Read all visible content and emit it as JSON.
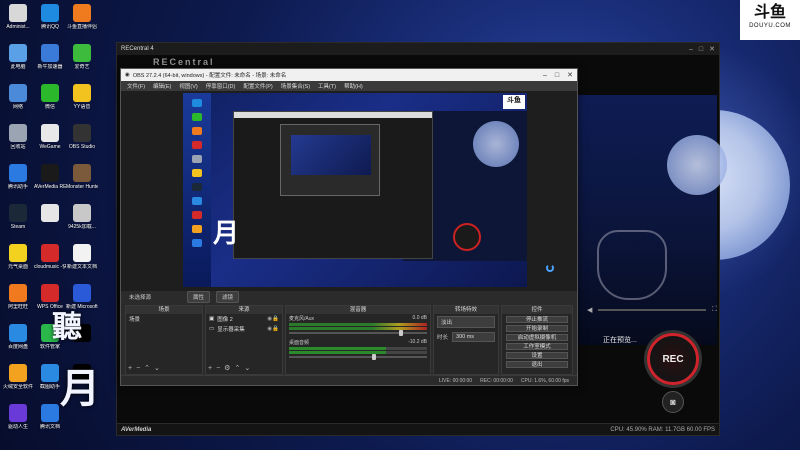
{
  "desktop": {
    "icons": [
      {
        "label": "Administ...",
        "color": "#d8d8d8"
      },
      {
        "label": "腾讯QQ",
        "color": "#1e8be0"
      },
      {
        "label": "斗鱼直播伴侣",
        "color": "#f07a1e"
      },
      {
        "label": "此电脑",
        "color": "#5aa0e6"
      },
      {
        "label": "新牛加速器",
        "color": "#3a7ad8"
      },
      {
        "label": "爱奇艺",
        "color": "#3dbb3d"
      },
      {
        "label": "网络",
        "color": "#4a8ad8"
      },
      {
        "label": "微信",
        "color": "#2bb82b"
      },
      {
        "label": "YY语音",
        "color": "#f2c21e"
      },
      {
        "label": "回收站",
        "color": "#9aa4b2"
      },
      {
        "label": "WeGame",
        "color": "#e8e8e8"
      },
      {
        "label": "OBS Studio",
        "color": "#333333"
      },
      {
        "label": "腾讯助手",
        "color": "#2a7ae2"
      },
      {
        "label": "AVerMedia RECentral 4",
        "color": "#1a1a1a"
      },
      {
        "label": "Monster Hunter...",
        "color": "#7a5a3a"
      },
      {
        "label": "Steam",
        "color": "#1b2838"
      },
      {
        "label": "",
        "color": "#e6e6e6"
      },
      {
        "label": "9425k加载...",
        "color": "#c8c8c8"
      },
      {
        "label": "元气桌面",
        "color": "#f2d21e"
      },
      {
        "label": "cloudmusic -快捷方式",
        "color": "#d42a2a"
      },
      {
        "label": "新建文本文档",
        "color": "#f2f2f2"
      },
      {
        "label": "阿里旺旺",
        "color": "#f27a1e"
      },
      {
        "label": "WPS Office",
        "color": "#d42a2a"
      },
      {
        "label": "新建 Microsoft Word 文档",
        "color": "#2a5ad8"
      },
      {
        "label": "百度网盘",
        "color": "#2a8ae2"
      },
      {
        "label": "软件管家",
        "color": "#2ab84a"
      },
      {
        "label": "",
        "color": "#000000"
      },
      {
        "label": "火绒安全软件",
        "color": "#f2a21e"
      },
      {
        "label": "截图助手",
        "color": "#2a8ae2"
      },
      {
        "label": "",
        "color": "#000000"
      },
      {
        "label": "驱动人生",
        "color": "#6a3ad8"
      },
      {
        "label": "腾讯文档",
        "color": "#2a7ae2"
      }
    ],
    "calligraphy": [
      "聽",
      "月",
      "月"
    ]
  },
  "douyu": {
    "mark": "斗鱼",
    "url": "DOUYU.COM"
  },
  "recentral": {
    "title": "RECentral 4",
    "logo": "RECentral",
    "preview_status": "正在预览...",
    "rec_label": "REC",
    "brand": "AVerMedia",
    "stats": "CPU: 45.90%  RAM: 11.7GB  60.00 FPS",
    "accent": "#d0242c"
  },
  "obs": {
    "title": "OBS 27.2.4 (64-bit, windows) - 配置文件: 未命名 - 场景: 未命名",
    "menu": [
      "文件(F)",
      "编辑(E)",
      "视图(V)",
      "停靠窗口(D)",
      "配置文件(P)",
      "场景集合(S)",
      "工具(T)",
      "帮助(H)"
    ],
    "status_label": "未选择源",
    "buttons": [
      "属性",
      "滤镜"
    ],
    "docks": {
      "scenes": {
        "header": "场景",
        "items": [
          "场景"
        ]
      },
      "sources": {
        "header": "来源",
        "items": [
          "图像 2",
          "显示器采集"
        ]
      },
      "mixer": {
        "header": "混音器",
        "channels": [
          {
            "name": "麦克风/Aux",
            "db": "0.0 dB"
          },
          {
            "name": "桌面音频",
            "db": "-10.2 dB"
          }
        ]
      },
      "transitions": {
        "header": "转场特效",
        "type": "淡出",
        "duration_label": "时长",
        "duration": "300 ms"
      },
      "controls": {
        "header": "控件",
        "buttons": [
          "停止推流",
          "开始录制",
          "启动虚拟摄像机",
          "工作室模式",
          "设置",
          "退出"
        ]
      }
    },
    "statusbar": [
      "LIVE: 00:00:00",
      "REC: 00:00:00",
      "CPU: 1.6%, 60.00 fps"
    ]
  }
}
